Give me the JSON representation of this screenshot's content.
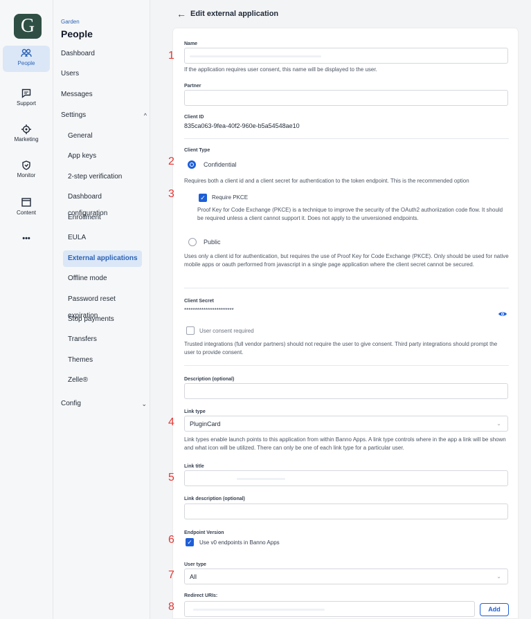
{
  "rail": {
    "logo_letter": "G",
    "items": [
      {
        "label": "People",
        "icon": "people-icon"
      },
      {
        "label": "Support",
        "icon": "chat-icon"
      },
      {
        "label": "Marketing",
        "icon": "target-icon"
      },
      {
        "label": "Monitor",
        "icon": "shield-icon"
      },
      {
        "label": "Content",
        "icon": "window-icon"
      },
      {
        "label": "•••",
        "icon": "more-icon"
      }
    ]
  },
  "nav": {
    "kicker": "Garden",
    "title": "People",
    "top_items": [
      "Dashboard",
      "Users",
      "Messages",
      "Settings"
    ],
    "settings_items": [
      "General",
      "App keys",
      "2-step verification",
      "Dashboard configuration",
      "Enrollment",
      "EULA",
      "External applications",
      "Offline mode",
      "Password reset expiration",
      "Stop payments",
      "Transfers",
      "Themes",
      "Zelle®"
    ],
    "config_label": "Config",
    "active_item": "External applications"
  },
  "header": {
    "back_glyph": "←",
    "title": "Edit external application"
  },
  "form": {
    "name": {
      "label": "Name",
      "help": "If the application requires user consent, this name will be displayed to the user."
    },
    "partner": {
      "label": "Partner"
    },
    "client_id": {
      "label": "Client ID",
      "value": "835ca063-9fea-40f2-960e-b5a54548ae10"
    },
    "client_type": {
      "label": "Client Type",
      "confidential": {
        "label": "Confidential",
        "desc": "Requires both a client id and a client secret for authentication to the token endpoint. This is the recommended option"
      },
      "pkce": {
        "label": "Require PKCE",
        "desc": "Proof Key for Code Exchange (PKCE) is a technique to improve the security of the OAuth2 authoriization code flow. It should be required unless a client cannot support it. Does not apply to the unversioned endpoints."
      },
      "public": {
        "label": "Public",
        "desc": "Uses only a client id for authentication, but requires the use of Proof Key for Code Exchange (PKCE). Only should be used for native mobile apps or oauth performed from javascript in a single page application where the client secret cannot be secured."
      }
    },
    "client_secret": {
      "label": "Client Secret",
      "value": "***********************"
    },
    "consent": {
      "label": "User consent required",
      "desc": "Trusted integrations (full vendor partners) should not require the user to give consent. Third party integrations should prompt the user to provide consent."
    },
    "description": {
      "label": "Description (optional)"
    },
    "link_type": {
      "label": "Link type",
      "value": "PluginCard",
      "help": "Link types enable launch points to this application from within Banno Apps. A link type controls where in the app a link will be shown and what icon will be utilized. There can only be one of each link type for a particular user."
    },
    "link_title": {
      "label": "Link title"
    },
    "link_description": {
      "label": "Link description (optional)"
    },
    "endpoint_version": {
      "label": "Endpoint Version",
      "option": "Use v0 endpoints in Banno Apps"
    },
    "user_type": {
      "label": "User type",
      "value": "All"
    },
    "redirect_uris": {
      "label": "Redirect URIs:",
      "add_label": "Add"
    }
  },
  "markers": [
    "1",
    "2",
    "3",
    "4",
    "5",
    "6",
    "7",
    "8"
  ],
  "colors": {
    "accent": "#1d5fd8",
    "marker": "#e53935",
    "active_nav_bg": "#dbe7f7"
  }
}
